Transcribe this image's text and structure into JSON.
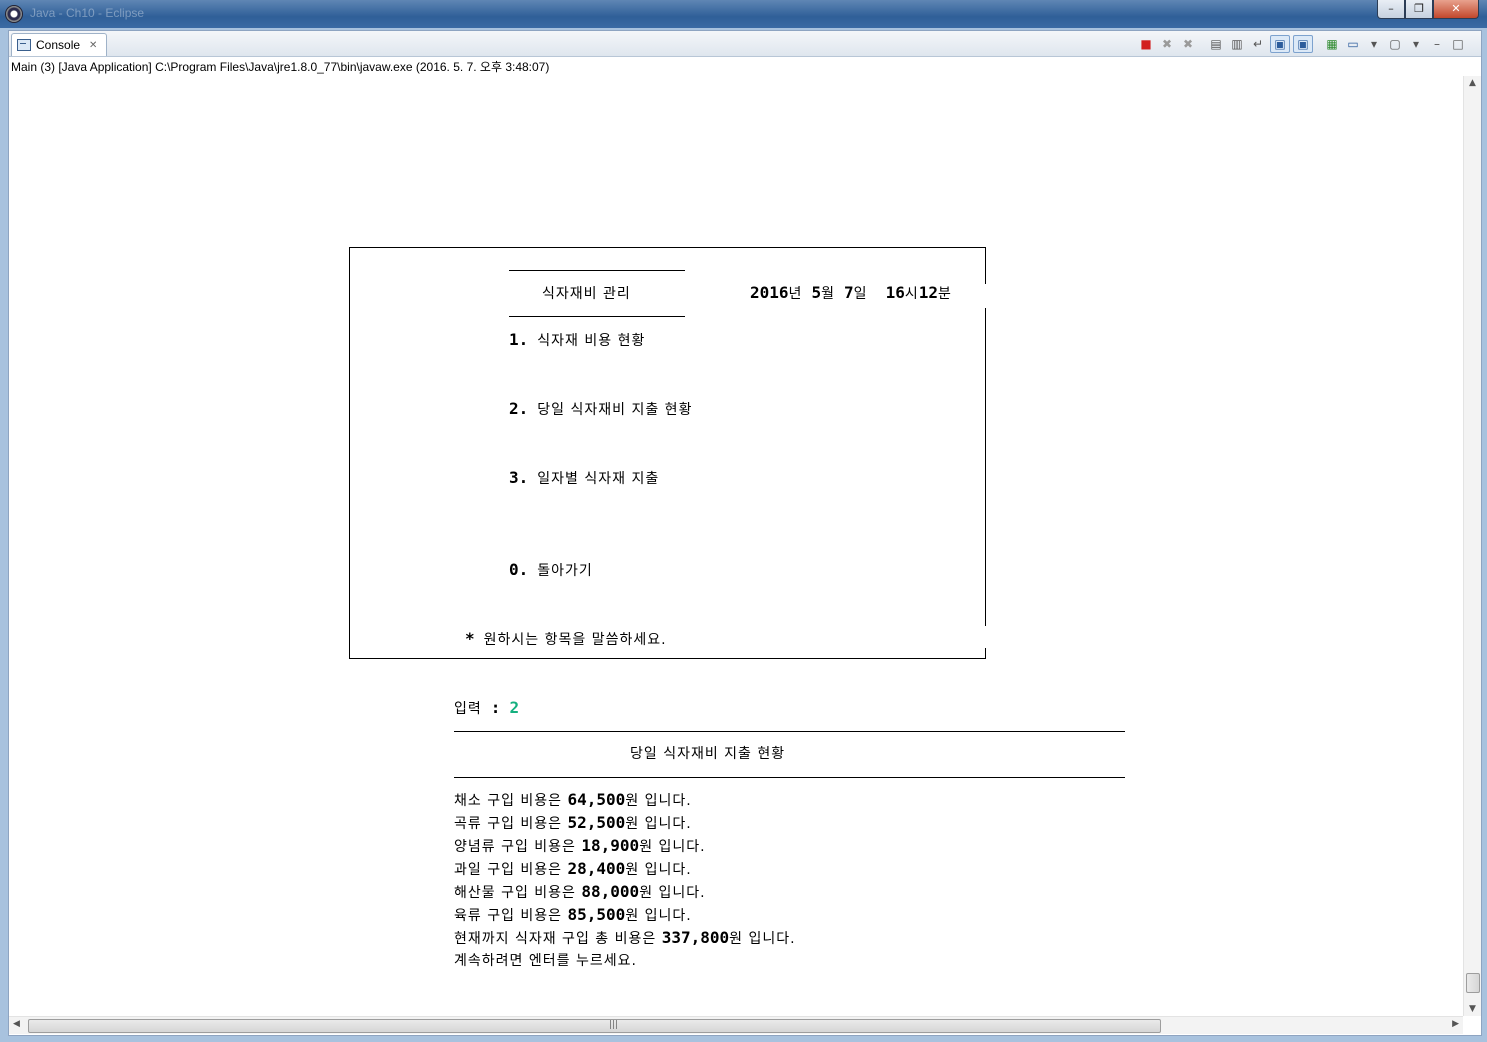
{
  "window": {
    "title": "Java - Ch10 - Eclipse",
    "minimize_glyph": "–",
    "restore_glyph": "❐",
    "close_glyph": "✕"
  },
  "tab": {
    "label": "Console",
    "close_glyph": "✕"
  },
  "toolbar": {
    "terminate_glyph": "■",
    "remove_launch_glyph": "✖",
    "remove_all_glyph": "✖",
    "clear_glyph": "▤",
    "scroll_lock_glyph": "▥",
    "word_wrap_glyph": "↵",
    "show_on_stdout_glyph": "▣",
    "show_on_stderr_glyph": "▣",
    "pin_glyph": "▦",
    "display_console_glyph": "▭",
    "open_console_glyph": "▢",
    "dropdown_glyph": "▾",
    "minimize_glyph": "–",
    "maximize_glyph": "□"
  },
  "process_line": "Main (3) [Java Application] C:\\Program Files\\Java\\jre1.8.0_77\\bin\\javaw.exe (2016. 5. 7. 오후 3:48:07)",
  "menu": {
    "title": "식자재비 관리",
    "date": {
      "year": "2016",
      "year_unit": "년",
      "month": "5",
      "month_unit": "월",
      "day": "7",
      "day_unit": "일",
      "hour": "16",
      "hour_unit": "시",
      "minute": "12",
      "minute_unit": "분"
    },
    "items": [
      {
        "num": "1.",
        "label": "식자재 비용 현황"
      },
      {
        "num": "2.",
        "label": "당일 식자재비 지출 현황"
      },
      {
        "num": "3.",
        "label": "일자별 식자재 지출"
      },
      {
        "num": "0.",
        "label": "돌아가기"
      }
    ],
    "prompt_star": "*",
    "prompt": "원하시는 항목을 말씀하세요."
  },
  "input": {
    "label": "입력",
    "colon": ":",
    "value": "2"
  },
  "report": {
    "title": "당일 식자재비 지출 현황",
    "lines": [
      {
        "pre": "채소 구입 비용은 ",
        "amount": "64,500",
        "post": "원 입니다."
      },
      {
        "pre": "곡류 구입 비용은 ",
        "amount": "52,500",
        "post": "원 입니다."
      },
      {
        "pre": "양념류 구입 비용은 ",
        "amount": "18,900",
        "post": "원 입니다."
      },
      {
        "pre": "과일 구입 비용은 ",
        "amount": "28,400",
        "post": "원 입니다."
      },
      {
        "pre": "해산물 구입 비용은 ",
        "amount": "88,000",
        "post": "원 입니다."
      },
      {
        "pre": "육류 구입 비용은 ",
        "amount": "85,500",
        "post": "원 입니다."
      },
      {
        "pre": "현재까지 식자재 구입 총 비용은 ",
        "amount": "337,800",
        "post": "원 입니다."
      }
    ],
    "continue": "계속하려면 엔터를 누르세요."
  },
  "colors": {
    "input_value": "#15b07f",
    "terminate": "#d21f1f",
    "title_bar": "#3a6aa4"
  }
}
